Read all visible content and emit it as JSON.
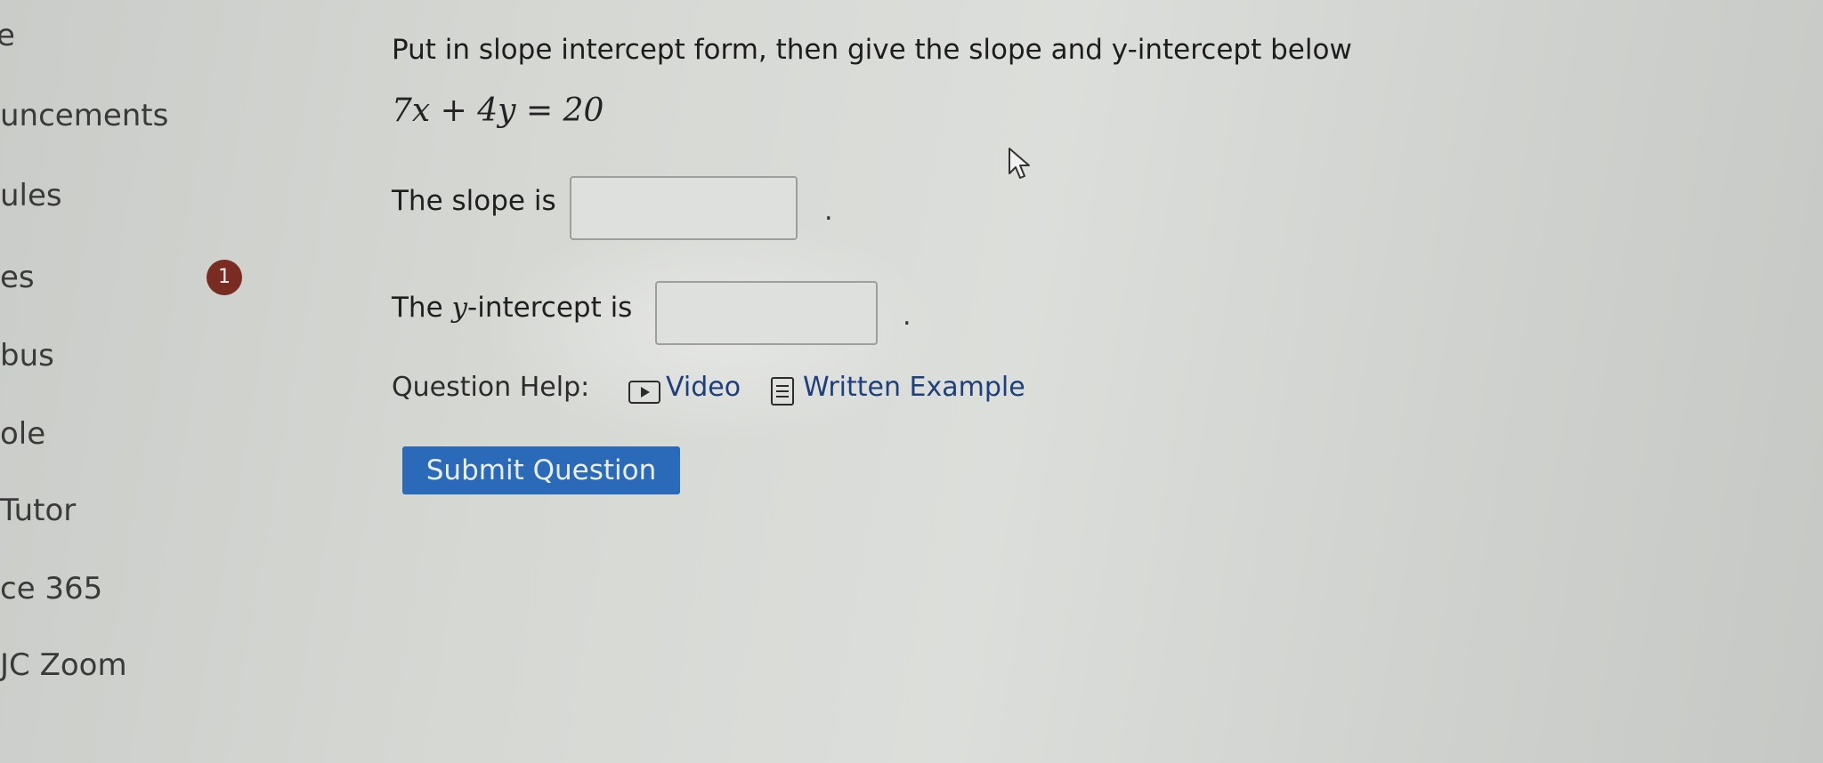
{
  "sidebar": {
    "items": [
      {
        "label": "e"
      },
      {
        "label": "uncements"
      },
      {
        "label": "ules"
      },
      {
        "label": "es"
      },
      {
        "label": "bus"
      },
      {
        "label": "ole"
      },
      {
        "label": "Tutor"
      },
      {
        "label": "ce 365"
      },
      {
        "label": "JC Zoom"
      }
    ],
    "badge_count": "1"
  },
  "question": {
    "prompt": "Put in slope intercept form, then give the slope and y-intercept below",
    "equation": "7x + 4y = 20",
    "slope_label": "The slope is",
    "slope_value": "",
    "intercept_label_pre": "The ",
    "intercept_var": "y",
    "intercept_label_post": "-intercept is",
    "intercept_value": "",
    "period": "."
  },
  "help": {
    "label": "Question Help:",
    "video_label": "Video",
    "written_label": "Written Example"
  },
  "submit_label": "Submit Question",
  "colors": {
    "submit_button": "#2a6ab8",
    "badge": "#7a2c22",
    "link": "#1d3f7a"
  },
  "icons": [
    "video-icon",
    "document-icon",
    "mouse-pointer-icon"
  ]
}
